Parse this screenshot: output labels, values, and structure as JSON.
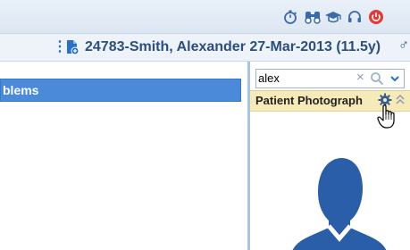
{
  "toolbar": {
    "icons": [
      "stopwatch-icon",
      "binoculars-icon",
      "graduation-cap-icon",
      "headset-icon",
      "power-icon"
    ],
    "power_color": "#e53935"
  },
  "patient": {
    "summary": "24783-Smith, Alexander 27-Mar-2013 (11.5y)",
    "gender_symbol": "♂"
  },
  "left_panel": {
    "section_label": "blems"
  },
  "right_panel": {
    "search": {
      "value": "alex",
      "clear_symbol": "×"
    },
    "widget": {
      "title": "Patient Photograph"
    }
  },
  "colors": {
    "accent_blue": "#4a8ad9",
    "header_text": "#2b4e7e",
    "widget_header_bg": "#f7eab9"
  }
}
